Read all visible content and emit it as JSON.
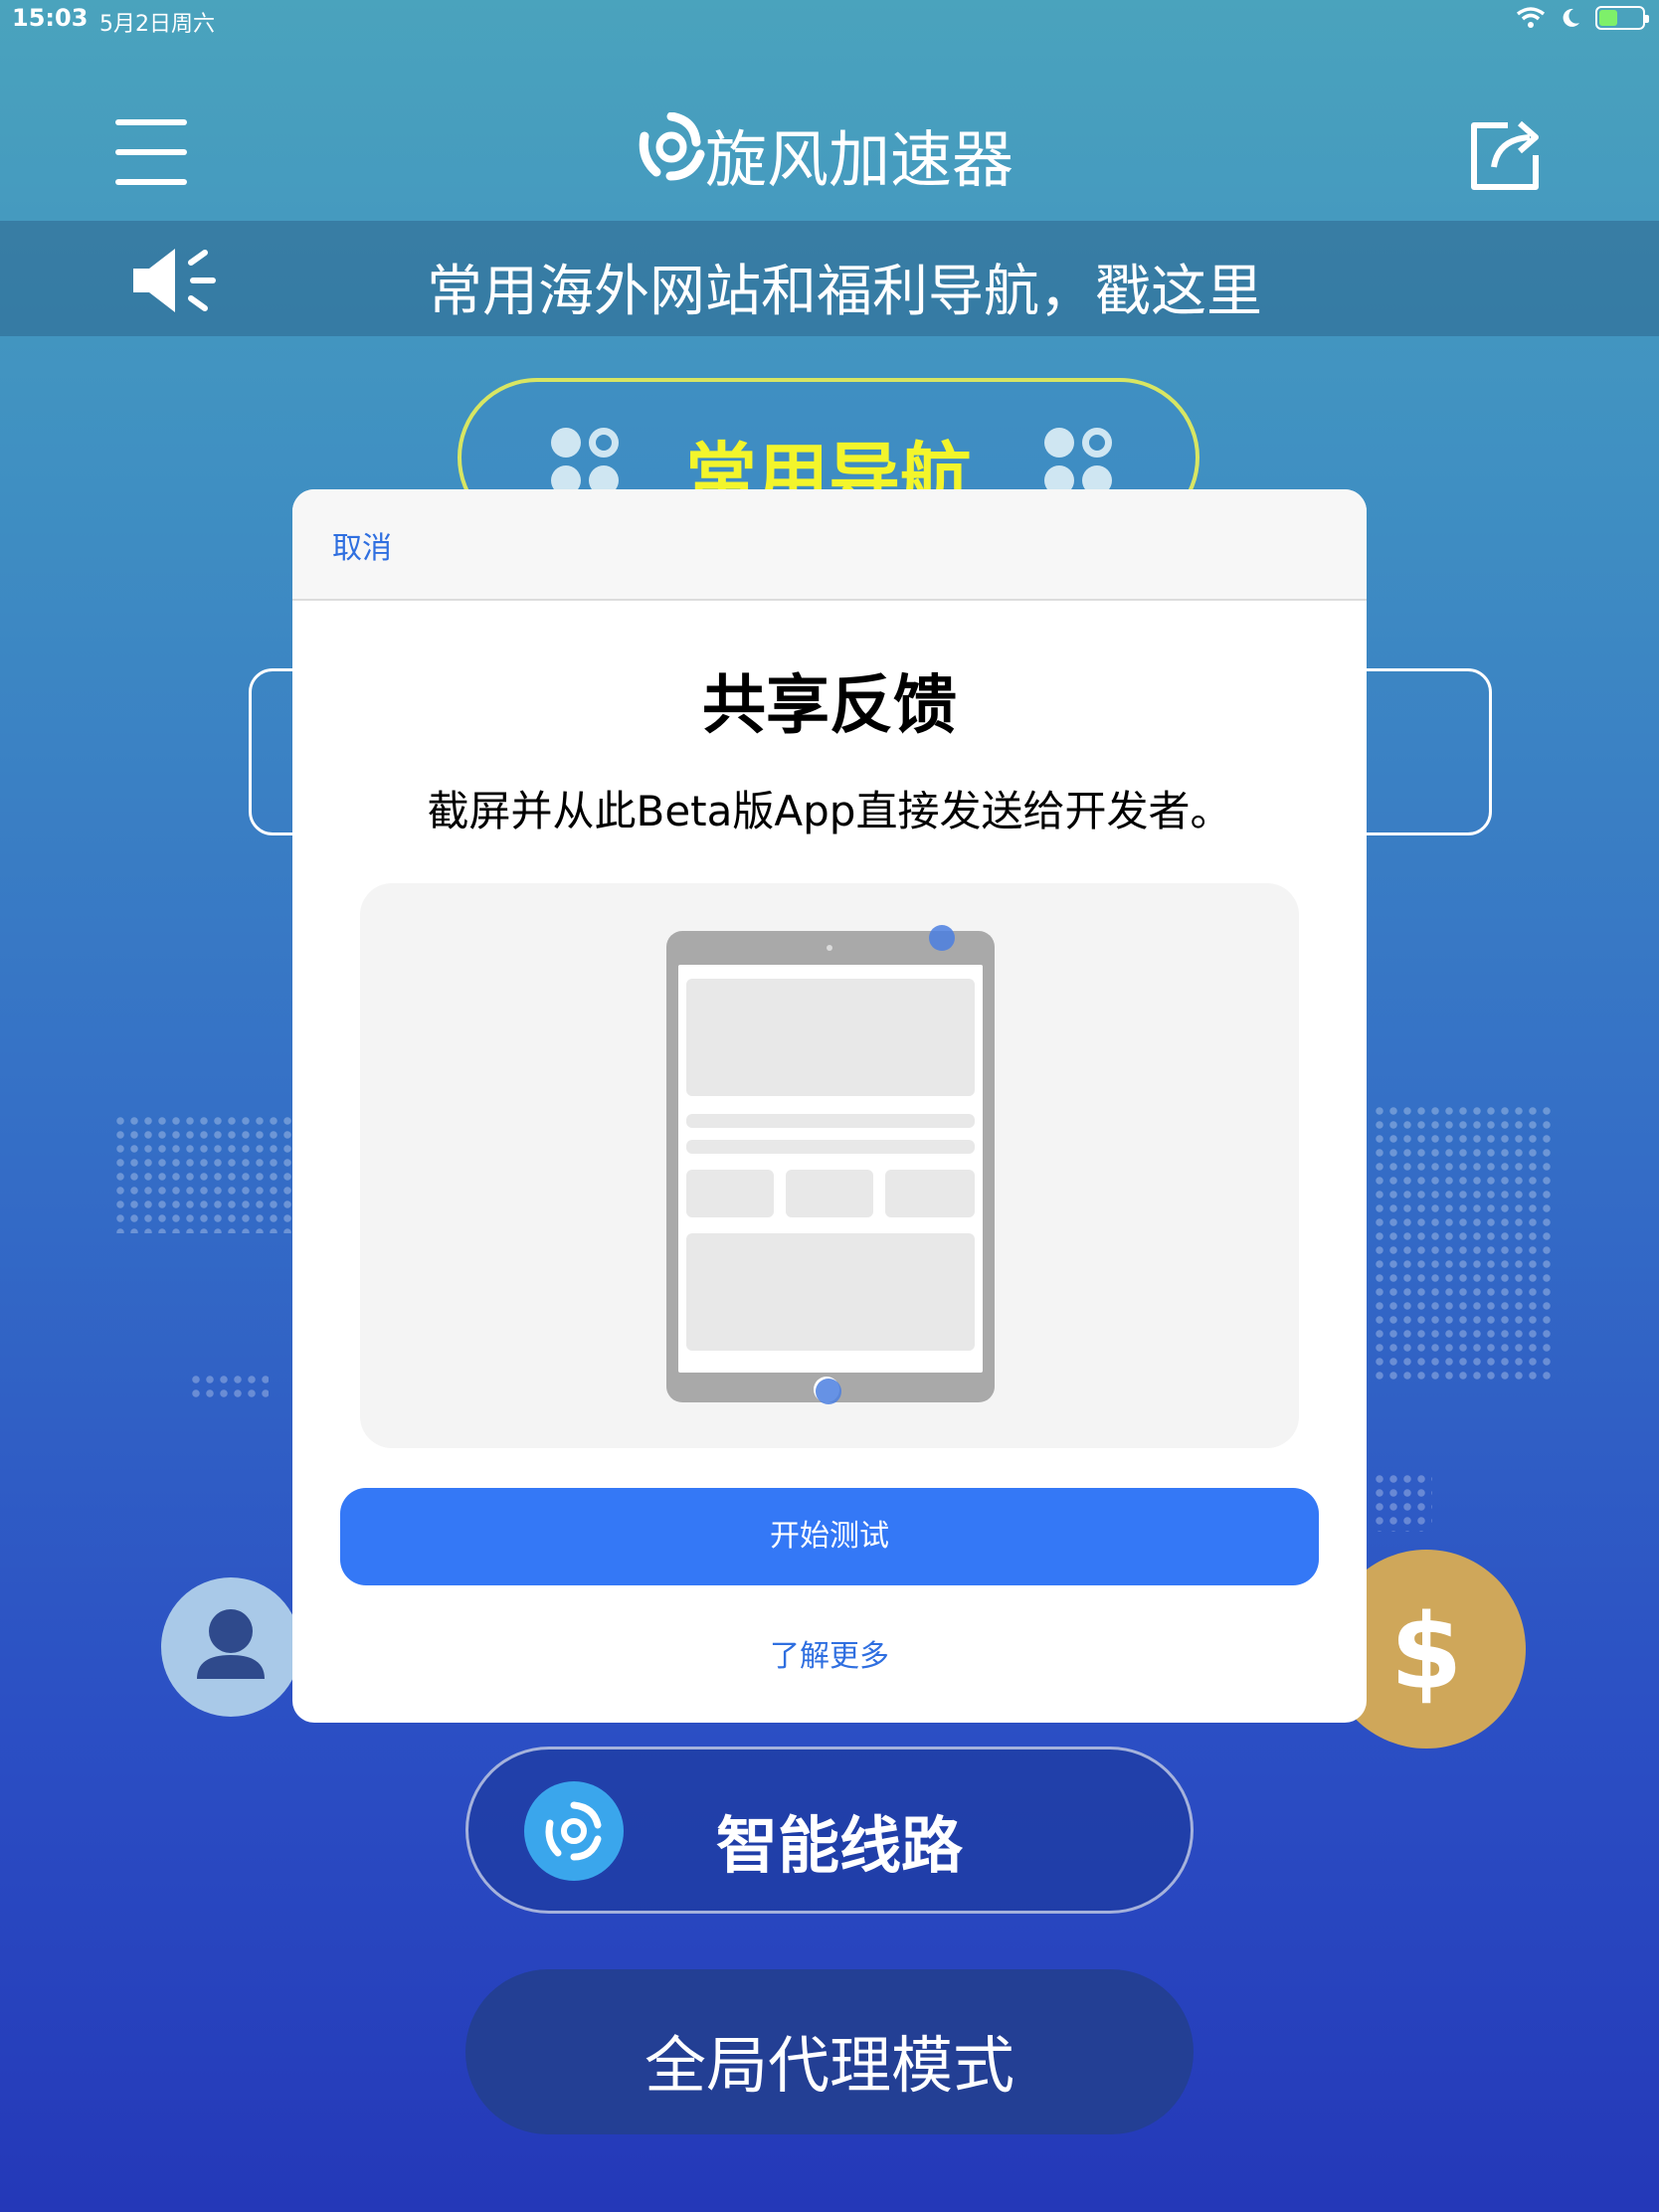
{
  "status_bar": {
    "time": "15:03",
    "date": "5月2日周六"
  },
  "header": {
    "app_title": "旋风加速器"
  },
  "announcement": {
    "text": "常用海外网站和福利导航，戳这里"
  },
  "nav_pill": {
    "label": "常用导航"
  },
  "coin_button": {
    "label": "$"
  },
  "route": {
    "label": "智能线路"
  },
  "mode": {
    "label": "全局代理模式"
  },
  "modal": {
    "cancel_label": "取消",
    "title": "共享反馈",
    "description": "截屏并从此Beta版App直接发送给开发者。",
    "start_label": "开始测试",
    "learn_more_label": "了解更多"
  },
  "colors": {
    "accent_blue": "#3478f6",
    "link_blue": "#2f6fe0",
    "nav_yellow": "#f3f52b",
    "coin_gold": "#cfa75a"
  }
}
